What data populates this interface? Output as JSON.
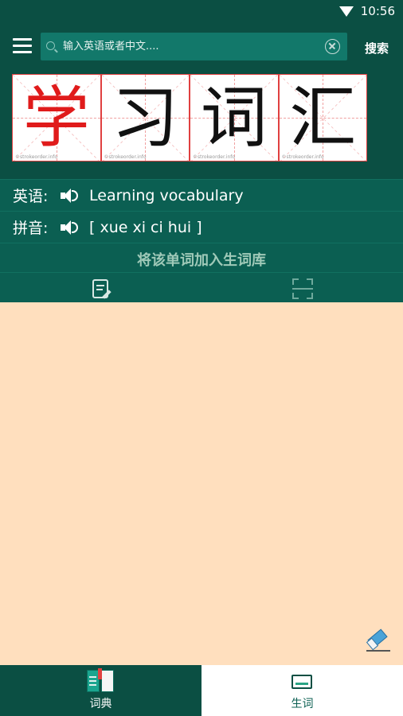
{
  "status_bar": {
    "time": "10:56"
  },
  "search": {
    "placeholder": "输入英语或者中文....",
    "value": "",
    "button_label": "搜索"
  },
  "characters": [
    {
      "char": "学",
      "color": "#e01b1b"
    },
    {
      "char": "习",
      "color": "#111111"
    },
    {
      "char": "词",
      "color": "#111111"
    },
    {
      "char": "汇",
      "color": "#111111"
    }
  ],
  "stroke_accent": "#e01b1b",
  "watermark": "©strokeorder.info",
  "english": {
    "label": "英语:",
    "value": "Learning vocabulary"
  },
  "pinyin": {
    "label": "拼音:",
    "value": "[ xue xi ci hui ]"
  },
  "add_word_label": "将该单词加入生词库",
  "tabs": [
    {
      "label": "词典",
      "icon": "dictionary-book-icon",
      "selected": true
    },
    {
      "label": "生词",
      "icon": "vocabulary-card-icon",
      "selected": false
    }
  ],
  "colors": {
    "primary": "#0b4f43",
    "secondary": "#0b5f52",
    "search_field": "#12786a",
    "content_background": "#ffdfbe"
  }
}
